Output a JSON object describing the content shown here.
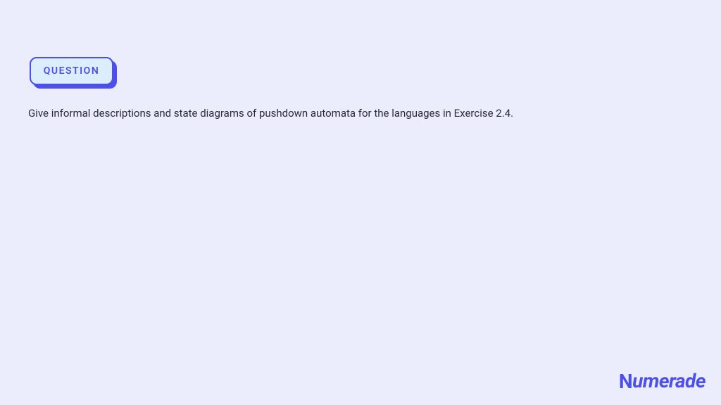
{
  "badge": {
    "label": "QUESTION"
  },
  "question": {
    "text": "Give informal descriptions and state diagrams of pushdown automata for the languages in Exercise 2.4."
  },
  "brand": {
    "name": "Numerade"
  }
}
